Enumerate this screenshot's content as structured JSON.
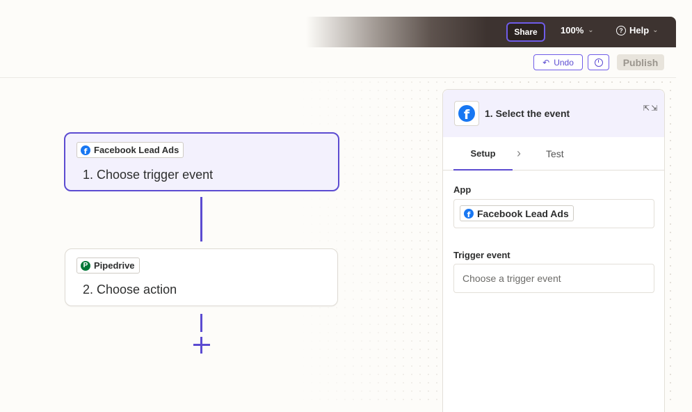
{
  "topbar": {
    "share_label": "Share",
    "zoom_label": "100%",
    "help_label": "Help"
  },
  "toolbar": {
    "undo_label": "Undo",
    "publish_label": "Publish"
  },
  "canvas": {
    "steps": [
      {
        "app": "Facebook Lead Ads",
        "title": "1. Choose trigger event"
      },
      {
        "app": "Pipedrive",
        "title": "2. Choose action"
      }
    ]
  },
  "panel": {
    "title": "1. Select the event",
    "tabs": {
      "setup": "Setup",
      "test": "Test"
    },
    "app_label": "App",
    "app_value": "Facebook Lead Ads",
    "trigger_label": "Trigger event",
    "trigger_placeholder": "Choose a trigger event"
  },
  "colors": {
    "accent": "#5b4bd1",
    "facebook": "#1877f2",
    "pipedrive": "#017737",
    "topbar_dark": "#3d3330"
  },
  "icons": [
    "facebook-icon",
    "pipedrive-icon",
    "undo-icon",
    "history-icon",
    "help-icon",
    "chevron-down-icon",
    "expand-icon",
    "chevron-right-icon",
    "plus-icon"
  ]
}
